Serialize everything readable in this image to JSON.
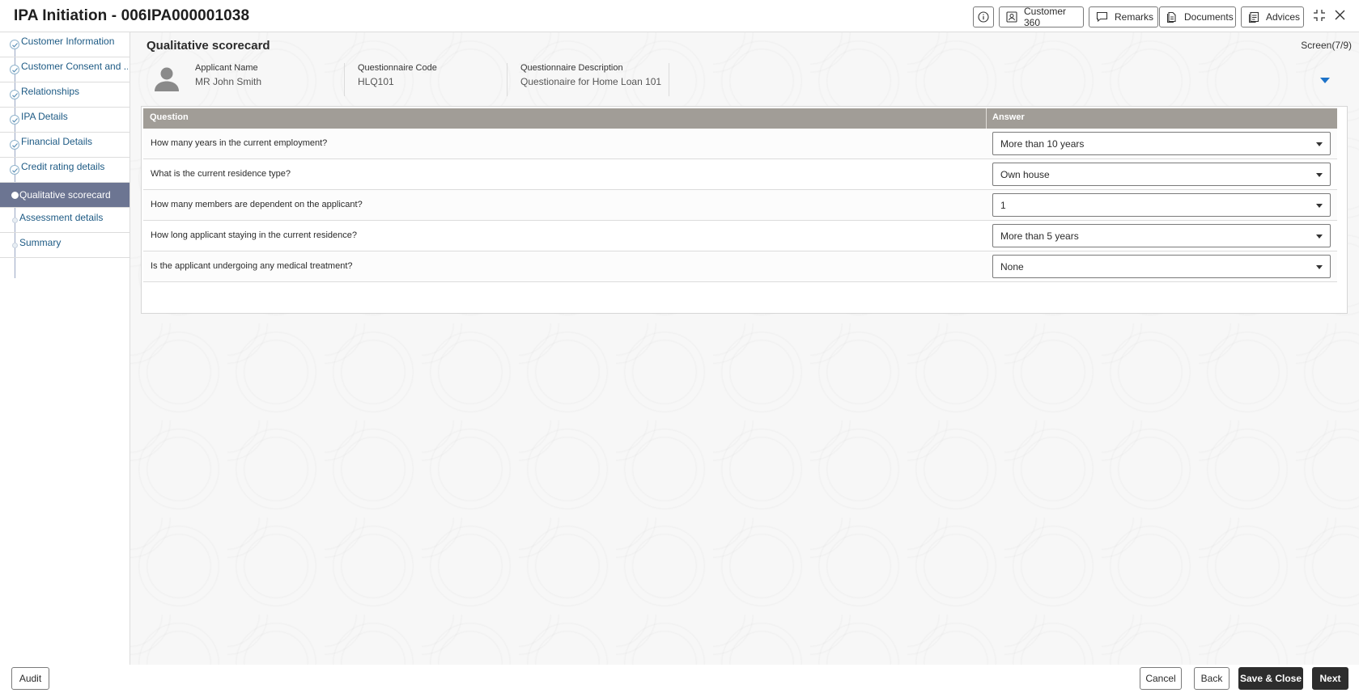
{
  "header": {
    "title": "IPA Initiation - 006IPA000001038",
    "buttons": {
      "customer360": "Customer 360",
      "remarks": "Remarks",
      "documents": "Documents",
      "advices": "Advices"
    }
  },
  "sidebar": {
    "items": [
      {
        "label": "Customer Information",
        "state": "done"
      },
      {
        "label": "Customer Consent and ...",
        "state": "done"
      },
      {
        "label": "Relationships",
        "state": "done"
      },
      {
        "label": "IPA Details",
        "state": "done"
      },
      {
        "label": "Financial Details",
        "state": "done"
      },
      {
        "label": "Credit rating details",
        "state": "done"
      },
      {
        "label": "Qualitative scorecard",
        "state": "active"
      },
      {
        "label": "Assessment details",
        "state": "pending"
      },
      {
        "label": "Summary",
        "state": "pending"
      }
    ]
  },
  "main": {
    "section_title": "Qualitative scorecard",
    "screen_count": "Screen(7/9)",
    "applicant": {
      "name_label": "Applicant Name",
      "name_value": "MR John Smith",
      "code_label": "Questionnaire Code",
      "code_value": "HLQ101",
      "desc_label": "Questionnaire Description",
      "desc_value": "Questionaire for Home Loan 101"
    },
    "table": {
      "headers": {
        "question": "Question",
        "answer": "Answer"
      },
      "rows": [
        {
          "question": "How many years in the current employment?",
          "answer": "More than 10 years"
        },
        {
          "question": "What is the current residence type?",
          "answer": "Own house"
        },
        {
          "question": "How many members are dependent on the applicant?",
          "answer": "1"
        },
        {
          "question": "How long applicant staying in the current residence?",
          "answer": "More than 5 years"
        },
        {
          "question": "Is the applicant undergoing any medical treatment?",
          "answer": "None"
        }
      ]
    }
  },
  "footer": {
    "audit": "Audit",
    "cancel": "Cancel",
    "back": "Back",
    "save_close": "Save & Close",
    "next": "Next"
  },
  "colors": {
    "active_nav_bg": "#6c7592",
    "nav_text": "#1d5a84",
    "table_header_bg": "#a19d97",
    "primary_button_bg": "#2d2d2d",
    "accent_caret": "#1d73c9"
  }
}
